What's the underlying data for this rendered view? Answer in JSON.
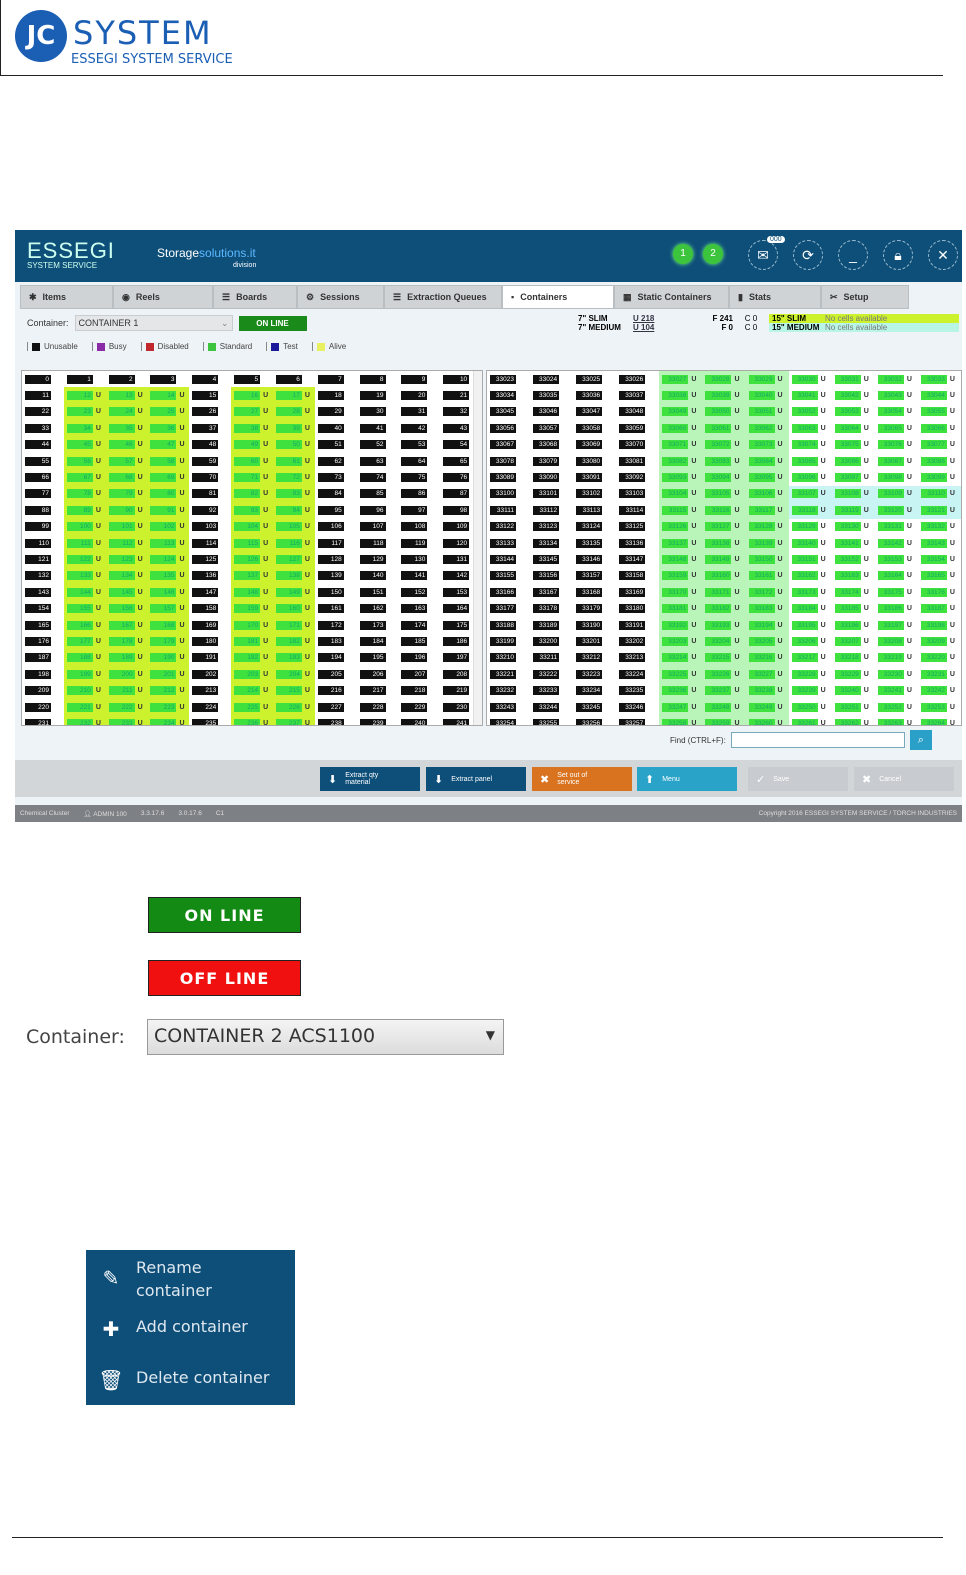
{
  "doc_logo": {
    "mark": "JC",
    "name": "SYSTEM",
    "sub": "ESSEGI SYSTEM SERVICE"
  },
  "app": {
    "brand": "ESSEGI",
    "brand_sub": "SYSTEM SERVICE",
    "storage_a": "Storage",
    "storage_b": "solutions.it",
    "storage_div": "division",
    "indicators": [
      "1",
      "2"
    ],
    "message_badge": "000",
    "tabs": [
      "Items",
      "Reels",
      "Boards",
      "Sessions",
      "Extraction Queues",
      "Containers",
      "Static Containers",
      "Stats",
      "Setup"
    ],
    "active_tab": "Containers",
    "container_label": "Container:",
    "container_value": "CONTAINER 1",
    "online_label": "ON LINE",
    "sizes": [
      {
        "name": "7\" SLIM",
        "u": "U 218",
        "f": "F 241",
        "c": "C 0",
        "name15": "15\" SLIM",
        "msg": "No cells available",
        "color": "#ccf22e"
      },
      {
        "name": "7\" MEDIUM",
        "u": "U 104",
        "f": "F 0",
        "c": "C 0",
        "name15": "15\" MEDIUM",
        "msg": "No cells available",
        "color": "#b9f5e6"
      }
    ],
    "legend": [
      {
        "label": "Unusable",
        "color": "#111111"
      },
      {
        "label": "Busy",
        "color": "#8a2ca8"
      },
      {
        "label": "Disabled",
        "color": "#c0282d"
      },
      {
        "label": "Standard",
        "color": "#3ec43e"
      },
      {
        "label": "Test",
        "color": "#1a1a9a"
      },
      {
        "label": "Alive",
        "color": "#e8f060"
      }
    ],
    "used_mark": "U",
    "left_grid": {
      "start": 0,
      "rows": 22,
      "cols": 11,
      "used_cols": [
        1,
        2,
        3,
        5,
        6
      ]
    },
    "right_grid": {
      "start": 33023,
      "rows": 22,
      "cols": 11,
      "used_cols": [
        4,
        5,
        6,
        7,
        8,
        9,
        10
      ]
    },
    "find_label": "Find (CTRL+F):",
    "find_value": "",
    "actions": [
      {
        "label": "Extract qty material",
        "icon": "arrow-down",
        "color": "#0e4f7a"
      },
      {
        "label": "Extract panel",
        "icon": "arrow-down",
        "color": "#0e4f7a"
      },
      {
        "label": "Set out of service",
        "icon": "x",
        "color": "#d9731f"
      },
      {
        "label": "Menu",
        "icon": "arrow-up",
        "color": "#2aa3c9"
      },
      {
        "label": "Save",
        "icon": "check",
        "color": "#c8cbcf"
      },
      {
        "label": "Cancel",
        "icon": "x",
        "color": "#c8cbcf"
      }
    ],
    "status": {
      "user_group": "Chemical Cluster",
      "user": "ADMIN 100",
      "v1": "3.3.17.6",
      "v2": "3.0.17.6",
      "extra": "C1",
      "copyright": "Copyright 2016 ESSEGI SYSTEM SERVICE / TORCH INDUSTRIES"
    }
  },
  "online_button": {
    "label": "ON LINE",
    "color": "#138a13"
  },
  "offline_button": {
    "label": "OFF LINE",
    "color": "#f01010"
  },
  "container_select": {
    "label": "Container:",
    "value": "CONTAINER 2 ACS1100"
  },
  "context_menu": [
    {
      "label": "Rename container",
      "icon": "pencil"
    },
    {
      "label": "Add container",
      "icon": "plus"
    },
    {
      "label": "Delete container",
      "icon": "trash"
    }
  ]
}
